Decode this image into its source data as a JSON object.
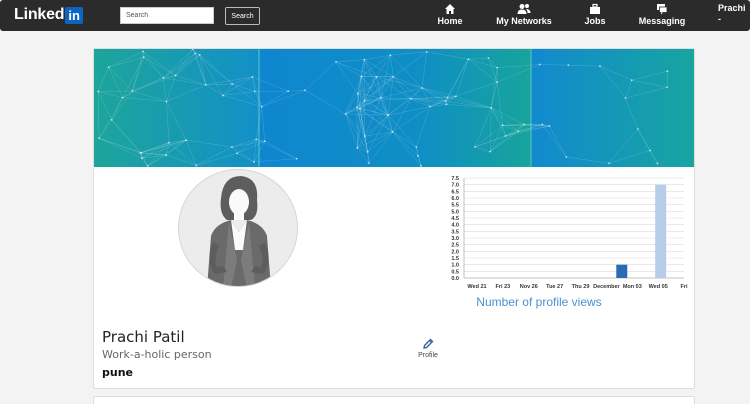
{
  "navbar": {
    "logo_text": "Linked",
    "logo_badge": "in",
    "search": {
      "placeholder": "Search",
      "button_label": "Search"
    },
    "items": [
      {
        "label": "Home",
        "icon": "home-icon"
      },
      {
        "label": "My Networks",
        "icon": "people-icon"
      },
      {
        "label": "Jobs",
        "icon": "briefcase-icon"
      },
      {
        "label": "Messaging",
        "icon": "chat-icon"
      }
    ],
    "user": {
      "name": "Prachi",
      "caret": "-"
    }
  },
  "profile": {
    "name": "Prachi Patil",
    "headline": "Work-a-holic person",
    "location": "pune",
    "edit_label": "Profile",
    "edit_icon": "pencil-icon"
  },
  "colors": {
    "navbar": "#2b2b2b",
    "brand": "#0a66c2",
    "bar_dark": "#2a6cb3",
    "bar_light": "#b6cde8",
    "chart_title": "#4a90d0"
  },
  "chart_data": {
    "type": "bar",
    "title": "Number of profile views",
    "categories": [
      "Wed 21",
      "Fri 23",
      "Nov 26",
      "Tue 27",
      "Thu 29",
      "December",
      "Mon 03",
      "Wed 05",
      "Fri"
    ],
    "series": [
      {
        "values": [
          0,
          0,
          0,
          0,
          0,
          0,
          1,
          7,
          0
        ]
      }
    ],
    "y_ticks": [
      "0.0",
      "0.5",
      "1.0",
      "1.5",
      "2.0",
      "2.5",
      "3.0",
      "3.5",
      "4.0",
      "4.5",
      "5.0",
      "5.5",
      "6.0",
      "6.5",
      "7.0",
      "7.5"
    ],
    "ylim": [
      0,
      7.5
    ],
    "grid": true
  }
}
